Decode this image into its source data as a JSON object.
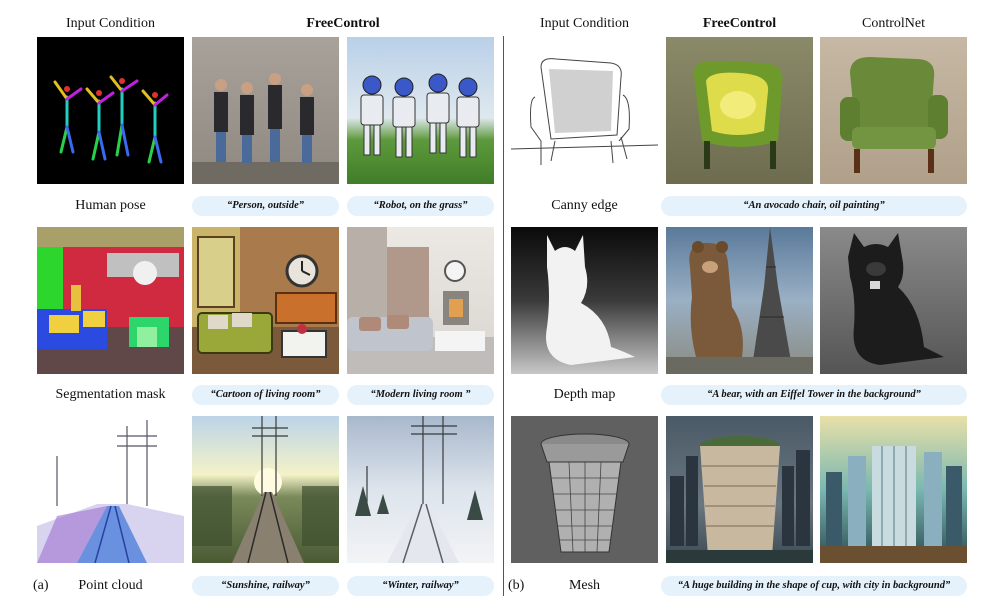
{
  "left": {
    "col_headers": [
      "Input Condition",
      "FreeControl",
      ""
    ],
    "rows": [
      {
        "label": "Human pose",
        "captions": [
          "“Person, outside”",
          "“Robot, on the grass”"
        ]
      },
      {
        "label": "Segmentation mask",
        "captions": [
          "“Cartoon of living room”",
          "“Modern living room ”"
        ]
      },
      {
        "label": "Point cloud",
        "captions": [
          "“Sunshine, railway”",
          "“Winter, railway”"
        ]
      }
    ],
    "panel_letter": "(a)"
  },
  "right": {
    "col_headers": [
      "Input Condition",
      "FreeControl",
      "ControlNet"
    ],
    "rows": [
      {
        "label": "Canny edge",
        "caption": "“An avocado chair, oil painting”"
      },
      {
        "label": "Depth map",
        "caption": "“A bear, with an Eiffel Tower in the background”"
      },
      {
        "label": "Mesh",
        "caption": "“A huge building in the shape of cup, with city in background”"
      }
    ],
    "panel_letter": "(b)"
  }
}
